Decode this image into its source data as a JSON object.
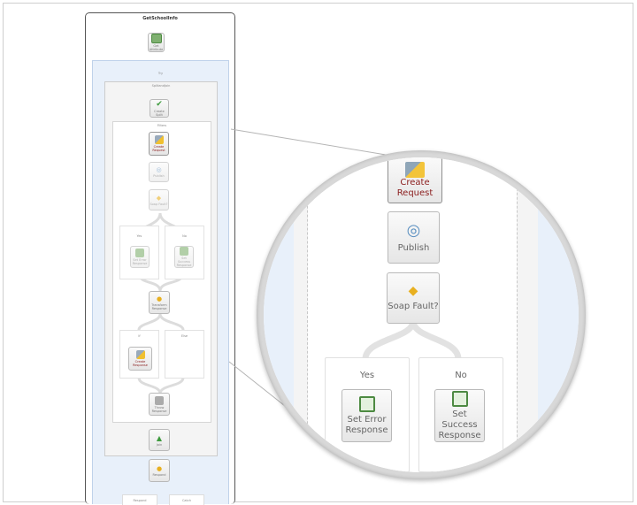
{
  "workflow": {
    "title": "GetSchoolInfo",
    "activities": {
      "top": "Get Attribute",
      "try_label": "Try",
      "sequence_label": "SplitandJoin",
      "split": "Create Split",
      "filters_label": "Filters",
      "create_request": "Create Request",
      "publish": "Publish",
      "soap_fault": "Soap Fault?",
      "set_error": "Set Error Response",
      "set_success": "Set Success Response",
      "transform": "Transform Response",
      "create_response": "Create Response",
      "throw": "Throw Response",
      "join": "Join",
      "end": "Respond",
      "branch_yes": "Yes",
      "branch_no": "No",
      "branch_if": "If",
      "branch_else": "Else",
      "bottom_left": "Respond",
      "bottom_right": "Catch"
    }
  },
  "zoom": {
    "create_request_line1": "Create",
    "create_request_line2": "Request",
    "publish": "Publish",
    "soap_fault": "Soap Fault?",
    "branch_yes": "Yes",
    "branch_no": "No",
    "set_error_line1": "Set Error",
    "set_error_line2": "Response",
    "set_success_line1": "Set Success",
    "set_success_line2": "Response"
  },
  "icons": {
    "document": "document-icon",
    "check": "check-icon",
    "edit": "edit-icon",
    "publish": "broadcast-icon",
    "fault": "diamond-icon",
    "join": "join-icon",
    "magnifier": "magnifier-lens"
  },
  "colors": {
    "create_request_text": "#8a1c1c",
    "zoom_text": "#666666",
    "try_panel": "#e8f0fa",
    "check_green": "#3c9a3c",
    "fault_orange": "#e8b020"
  }
}
